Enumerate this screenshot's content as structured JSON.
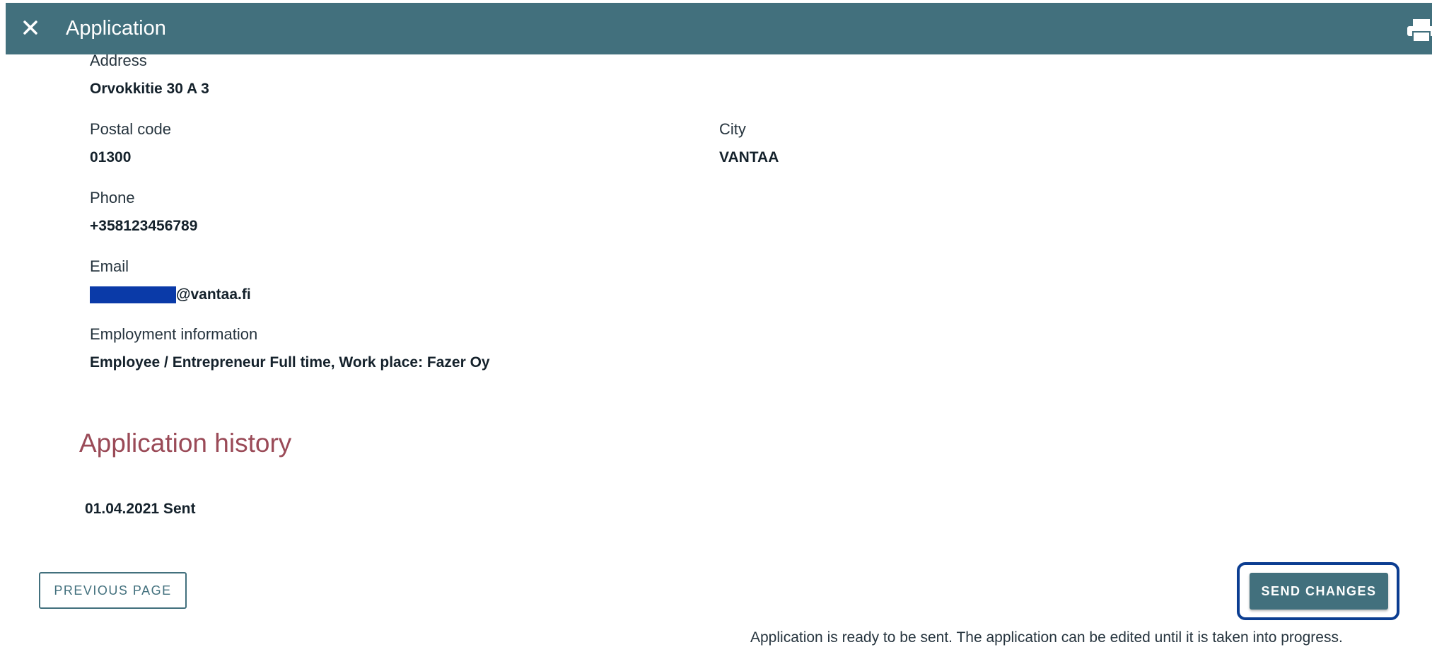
{
  "header": {
    "close_icon": "close-icon",
    "title": "Application",
    "print_icon": "print-icon",
    "background_color": "#42707d"
  },
  "fields": {
    "address_label": "Address",
    "address_value": "Orvokkitie 30 A 3",
    "postal_code_label": "Postal code",
    "postal_code_value": "01300",
    "city_label": "City",
    "city_value": "VANTAA",
    "phone_label": "Phone",
    "phone_value": "+358123456789",
    "email_label": "Email",
    "email_value": "@vantaa.fi",
    "employment_label": "Employment information",
    "employment_value": "Employee / Entrepreneur Full time, Work place: Fazer Oy"
  },
  "history": {
    "title": "Application history",
    "entries": [
      "01.04.2021 Sent"
    ]
  },
  "actions": {
    "previous_label": "PREVIOUS PAGE",
    "send_label": "SEND CHANGES",
    "status_message": "Application is ready to be sent. The application can be edited until it is taken into progress."
  },
  "colors": {
    "accent": "#42707d",
    "section_title": "#9a4a57",
    "highlight_border": "#0b3d91"
  }
}
